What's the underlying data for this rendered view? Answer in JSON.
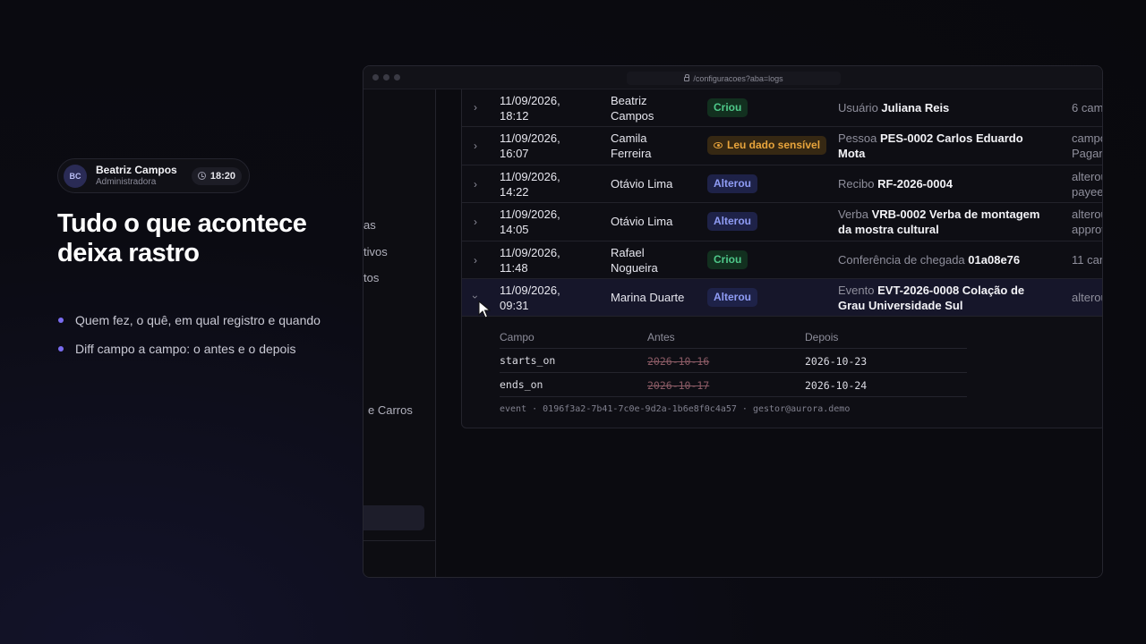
{
  "user": {
    "initials": "BC",
    "name": "Beatriz Campos",
    "role": "Administradora",
    "time": "18:20"
  },
  "headline": "Tudo o que acontece deixa rastro",
  "bullets": [
    "Quem fez, o quê, em qual registro e quando",
    "Diff campo a campo: o antes e o depois"
  ],
  "window": {
    "url": "/configuracoes?aba=logs"
  },
  "sidebar": {
    "items": [
      "as",
      "tivos",
      "tos",
      "e Carros"
    ]
  },
  "rows": [
    {
      "date": "11/09/2026,",
      "time": "18:12",
      "user1": "Beatriz",
      "user2": "Campos",
      "action": "Criou",
      "target_type": "Usuário",
      "target_name": "Juliana Reis",
      "target_name2": "",
      "changes1": "6 cam",
      "changes2": ""
    },
    {
      "date": "11/09/2026,",
      "time": "16:07",
      "user1": "Camila",
      "user2": "Ferreira",
      "action": "Leu dado sensível",
      "target_type": "Pessoa",
      "target_name": "PES-0002 Carlos Eduardo",
      "target_name2": "Mota",
      "changes1": "campo",
      "changes2": "Pagan"
    },
    {
      "date": "11/09/2026,",
      "time": "14:22",
      "user1": "Otávio Lima",
      "user2": "",
      "action": "Alterou",
      "target_type": "Recibo",
      "target_name": "RF-2026-0004",
      "target_name2": "",
      "changes1": "alterou",
      "changes2": "payee"
    },
    {
      "date": "11/09/2026,",
      "time": "14:05",
      "user1": "Otávio Lima",
      "user2": "",
      "action": "Alterou",
      "target_type": "Verba",
      "target_name": "VRB-0002 Verba de montagem",
      "target_name2": "da mostra cultural",
      "changes1": "alterou",
      "changes2": "approv"
    },
    {
      "date": "11/09/2026,",
      "time": "11:48",
      "user1": "Rafael",
      "user2": "Nogueira",
      "action": "Criou",
      "target_type": "Conferência de chegada",
      "target_name": "01a08e76",
      "target_name2": "",
      "changes1": "11 cam",
      "changes2": ""
    },
    {
      "date": "11/09/2026,",
      "time": "09:31",
      "user1": "Marina Duarte",
      "user2": "",
      "action": "Alterou",
      "target_type": "Evento",
      "target_name": "EVT-2026-0008 Colação de",
      "target_name2": "Grau Universidade Sul",
      "changes1": "alterou",
      "changes2": ""
    }
  ],
  "detail": {
    "headers": {
      "field": "Campo",
      "before": "Antes",
      "after": "Depois"
    },
    "changes": [
      {
        "field": "starts_on",
        "before": "2026-10-16",
        "after": "2026-10-23"
      },
      {
        "field": "ends_on",
        "before": "2026-10-17",
        "after": "2026-10-24"
      }
    ],
    "meta": "event · 0196f3a2-7b41-7c0e-9d2a-1b6e8f0c4a57 · gestor@aurora.demo"
  },
  "colors": {
    "accent": "#7a6cf0",
    "green": "#4fc98a",
    "blue": "#8f9cf5",
    "amber": "#e9a53c"
  }
}
